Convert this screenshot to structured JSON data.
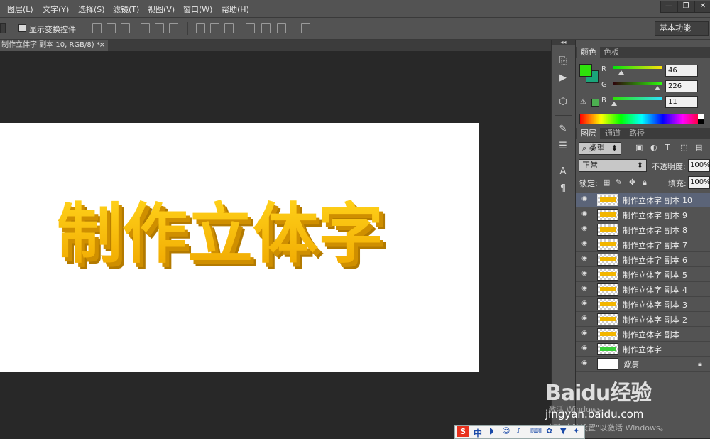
{
  "menu": [
    "图层(L)",
    "文字(Y)",
    "选择(S)",
    "滤镜(T)",
    "视图(V)",
    "窗口(W)",
    "帮助(H)"
  ],
  "window_controls": {
    "minimize": "—",
    "restore": "❐",
    "close": "✕"
  },
  "options": {
    "show_transform_label": "显示变换控件",
    "workspace": "基本功能"
  },
  "document": {
    "tab_title": "制作立体字 副本 10, RGB/8) *",
    "tab_close": "×",
    "artwork_text": "制作立体字",
    "artwork_color": "#f5b800",
    "artwork_shadow": "#b07800"
  },
  "color_panel": {
    "tabs": [
      "颜色",
      "色板"
    ],
    "foreground": "#2ee20b",
    "background": "#1aa57a",
    "r": {
      "label": "R",
      "value": "46"
    },
    "g": {
      "label": "G",
      "value": "226"
    },
    "b": {
      "label": "B",
      "value": "11"
    }
  },
  "layers_panel": {
    "tabs": [
      "图层",
      "通道",
      "路径"
    ],
    "filter_kind": "类型",
    "blend_mode": "正常",
    "opacity_label": "不透明度:",
    "opacity_value": "100%",
    "lock_label": "锁定:",
    "fill_label": "填充:",
    "fill_value": "100%",
    "layers": [
      {
        "name": "制作立体字 副本 10",
        "selected": true
      },
      {
        "name": "制作立体字 副本 9",
        "selected": false
      },
      {
        "name": "制作立体字 副本 8",
        "selected": false
      },
      {
        "name": "制作立体字 副本 7",
        "selected": false
      },
      {
        "name": "制作立体字 副本 6",
        "selected": false
      },
      {
        "name": "制作立体字 副本 5",
        "selected": false
      },
      {
        "name": "制作立体字 副本 4",
        "selected": false
      },
      {
        "name": "制作立体字 副本 3",
        "selected": false
      },
      {
        "name": "制作立体字 副本 2",
        "selected": false
      },
      {
        "name": "制作立体字 副本",
        "selected": false
      },
      {
        "name": "制作立体字",
        "selected": false
      },
      {
        "name": "背景",
        "selected": false
      }
    ]
  },
  "watermark": {
    "brand": "Baidu经验",
    "url": "jingyan.baidu.com",
    "activate_title": "激活 Windows",
    "activate_sub": "转到\"电脑设置\"以激活 Windows。"
  },
  "ime_bar": {
    "logo": "S",
    "mode": "中"
  }
}
